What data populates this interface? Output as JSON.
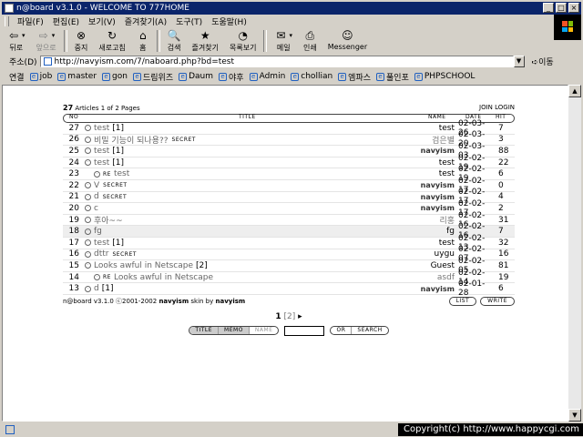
{
  "window": {
    "title": "n@board v3.1.0 - WELCOME TO 777HOME"
  },
  "menu": [
    "파일(F)",
    "편집(E)",
    "보기(V)",
    "즐겨찾기(A)",
    "도구(T)",
    "도움말(H)"
  ],
  "toolbar": [
    {
      "label": "뒤로",
      "icon": "back-arrow-icon",
      "glyph": "⇦",
      "dropdown": true,
      "disabled": false
    },
    {
      "label": "앞으로",
      "icon": "forward-arrow-icon",
      "glyph": "⇨",
      "dropdown": true,
      "disabled": true
    },
    {
      "label": "중지",
      "icon": "stop-icon",
      "glyph": "⊗",
      "dropdown": false,
      "disabled": false
    },
    {
      "label": "새로고침",
      "icon": "refresh-icon",
      "glyph": "↻",
      "dropdown": false,
      "disabled": false
    },
    {
      "label": "홈",
      "icon": "home-icon",
      "glyph": "⌂",
      "dropdown": false,
      "disabled": false
    },
    {
      "label": "검색",
      "icon": "search-icon",
      "glyph": "🔍",
      "dropdown": false,
      "disabled": false
    },
    {
      "label": "즐겨찾기",
      "icon": "favorites-icon",
      "glyph": "★",
      "dropdown": false,
      "disabled": false
    },
    {
      "label": "목록보기",
      "icon": "history-icon",
      "glyph": "◔",
      "dropdown": false,
      "disabled": false
    },
    {
      "label": "메일",
      "icon": "mail-icon",
      "glyph": "✉",
      "dropdown": true,
      "disabled": false
    },
    {
      "label": "인쇄",
      "icon": "print-icon",
      "glyph": "⎙",
      "dropdown": false,
      "disabled": false
    },
    {
      "label": "Messenger",
      "icon": "messenger-icon",
      "glyph": "☺",
      "dropdown": false,
      "disabled": false
    }
  ],
  "address": {
    "label": "주소(D)",
    "url": "http://navyism.com/7/naboard.php?bd=test",
    "go": "이동"
  },
  "links": {
    "label": "연결",
    "items": [
      "job",
      "master",
      "gon",
      "드림위즈",
      "Daum",
      "야후",
      "Admin",
      "chollian",
      "엠파스",
      "풀인포",
      "PHPSCHOOL"
    ]
  },
  "board": {
    "count_num": "27",
    "count_text": " Articles 1 of 2 Pages",
    "join": "JOIN",
    "login": "LOGIN",
    "col_no": "NO",
    "col_title": "TITLE",
    "col_name": "NAME",
    "col_date": "DATE",
    "col_hit": "HIT",
    "rows": [
      {
        "no": "27",
        "title": "test",
        "re": "",
        "cmt": "[1]",
        "secret": "",
        "name": "test",
        "name_style": "plain",
        "date": "02-03-26",
        "hit": "7",
        "hl": false
      },
      {
        "no": "26",
        "title": "비밀 기능이 되나용??",
        "re": "",
        "cmt": "",
        "secret": "SECRET",
        "name": "검은별",
        "name_style": "grey",
        "date": "02-03-20",
        "hit": "3",
        "hl": false
      },
      {
        "no": "25",
        "title": "test",
        "re": "",
        "cmt": "[1]",
        "secret": "",
        "name": "navyism",
        "name_style": "navy",
        "date": "02-03-03",
        "hit": "88",
        "hl": false
      },
      {
        "no": "24",
        "title": "test",
        "re": "",
        "cmt": "[1]",
        "secret": "",
        "name": "test",
        "name_style": "plain",
        "date": "02-02-19",
        "hit": "22",
        "hl": false
      },
      {
        "no": "23",
        "title": "test",
        "re": "RE",
        "cmt": "",
        "secret": "",
        "name": "test",
        "name_style": "plain",
        "date": "02-02-19",
        "hit": "6",
        "hl": false
      },
      {
        "no": "22",
        "title": "V",
        "re": "",
        "cmt": "",
        "secret": "SECRET",
        "name": "navyism",
        "name_style": "navy",
        "date": "02-02-17",
        "hit": "0",
        "hl": false
      },
      {
        "no": "21",
        "title": "d",
        "re": "",
        "cmt": "",
        "secret": "SECRET",
        "name": "navyism",
        "name_style": "navy",
        "date": "02-02-17",
        "hit": "4",
        "hl": false
      },
      {
        "no": "20",
        "title": "c",
        "re": "",
        "cmt": "",
        "secret": "",
        "name": "navyism",
        "name_style": "navy",
        "date": "02-02-17",
        "hit": "2",
        "hl": false
      },
      {
        "no": "19",
        "title": "후아~~",
        "re": "",
        "cmt": "",
        "secret": "",
        "name": "리홍",
        "name_style": "grey",
        "date": "02-02-16",
        "hit": "31",
        "hl": false
      },
      {
        "no": "18",
        "title": "fg",
        "re": "",
        "cmt": "",
        "secret": "",
        "name": "fg",
        "name_style": "plain",
        "date": "02-02-16",
        "hit": "7",
        "hl": true
      },
      {
        "no": "17",
        "title": "test",
        "re": "",
        "cmt": "[1]",
        "secret": "",
        "name": "test",
        "name_style": "plain",
        "date": "02-02-13",
        "hit": "32",
        "hl": false
      },
      {
        "no": "16",
        "title": "dttr",
        "re": "",
        "cmt": "",
        "secret": "SECRET",
        "name": "uygu",
        "name_style": "plain",
        "date": "02-02-07",
        "hit": "16",
        "hl": false
      },
      {
        "no": "15",
        "title": "Looks awful in Netscape",
        "re": "",
        "cmt": "[2]",
        "secret": "",
        "name": "Guest",
        "name_style": "plain",
        "date": "02-02-05",
        "hit": "81",
        "hl": false
      },
      {
        "no": "14",
        "title": "Looks awful in Netscape",
        "re": "RE",
        "cmt": "",
        "secret": "",
        "name": "asdf",
        "name_style": "grey",
        "date": "02-02-14",
        "hit": "19",
        "hl": false
      },
      {
        "no": "13",
        "title": "d",
        "re": "",
        "cmt": "[1]",
        "secret": "",
        "name": "navyism",
        "name_style": "navy",
        "date": "02-01-28",
        "hit": "6",
        "hl": false
      }
    ],
    "footer_pre": "n@board v3.1.0 ⓒ2001-2002 ",
    "footer_author": "navyism",
    "footer_mid": " skin by ",
    "footer_skin": "navyism",
    "list_btn": "LIST",
    "write_btn": "WRITE",
    "pager_current": "1",
    "pager_other": "[2]",
    "pager_next": "▸",
    "search_title": "TITLE",
    "search_memo": "MEMO",
    "search_name": "NAME",
    "search_or": "OR",
    "search_btn": "SEARCH"
  },
  "status": {
    "copyright": "Copyright(c) http://www.happycgi.com"
  }
}
